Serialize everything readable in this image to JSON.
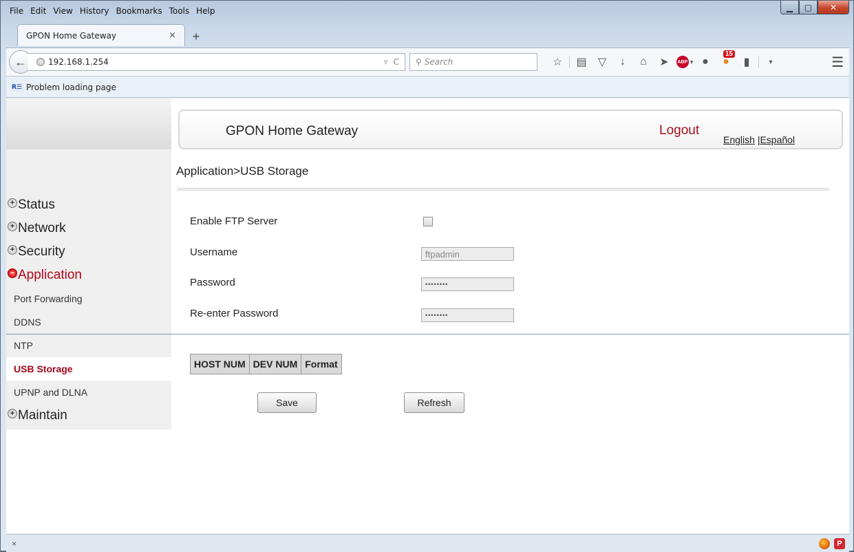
{
  "browser": {
    "menus": [
      "File",
      "Edit",
      "View",
      "History",
      "Bookmarks",
      "Tools",
      "Help"
    ],
    "tab": {
      "title": "GPON Home Gateway",
      "close": "×",
      "new_tab": "+"
    },
    "url": "192.168.1.254",
    "search_placeholder": "Search",
    "bookmark": "Problem loading page",
    "notification_count": "15",
    "adblock_label": "ABP",
    "status_close": "×"
  },
  "header": {
    "brand": "GPON Home Gateway",
    "logout": "Logout",
    "lang_english": "English",
    "lang_sep": "|",
    "lang_spanish": "Español"
  },
  "breadcrumb": "Application>USB Storage",
  "sidebar": {
    "groups": [
      {
        "label": "Status",
        "state": "collapsed"
      },
      {
        "label": "Network",
        "state": "collapsed"
      },
      {
        "label": "Security",
        "state": "collapsed"
      },
      {
        "label": "Application",
        "state": "expanded"
      }
    ],
    "subitems": [
      "Port Forwarding",
      "DDNS",
      "NTP",
      "USB Storage",
      "UPNP and DLNA"
    ],
    "selected": "USB Storage",
    "last_group": {
      "label": "Maintain",
      "state": "collapsed"
    }
  },
  "form": {
    "enable_ftp_label": "Enable FTP Server",
    "enable_ftp_checked": false,
    "username_label": "Username",
    "username_value": "ftpadmin",
    "password_label": "Password",
    "password_value": "••••••••",
    "reenter_label": "Re-enter Password",
    "reenter_value": "••••••••"
  },
  "table": {
    "columns": [
      "HOST NUM",
      "DEV NUM",
      "Format"
    ]
  },
  "buttons": {
    "save": "Save",
    "refresh": "Refresh"
  },
  "colors": {
    "accent_red": "#a3101d",
    "divider_blue": "#7a9ab7",
    "sidebar_bg": "#efefef"
  }
}
